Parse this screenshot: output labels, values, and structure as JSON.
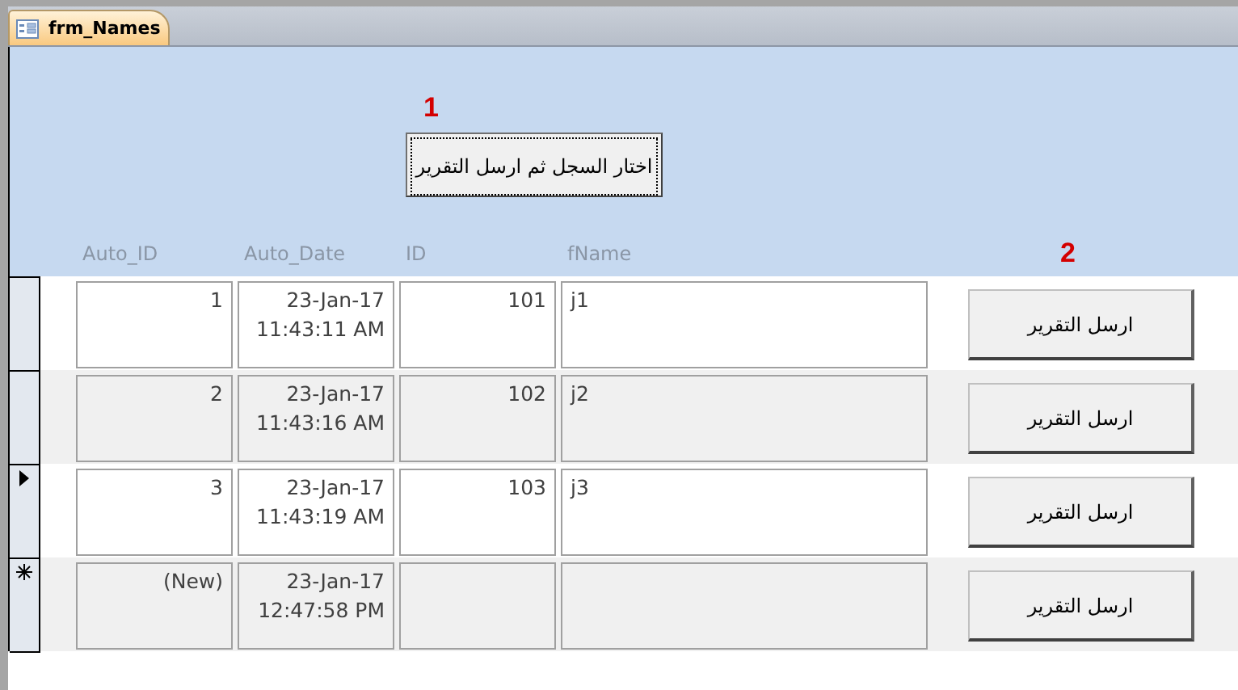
{
  "tab": {
    "title": "frm_Names",
    "selected": true
  },
  "header": {
    "marker_1": "1",
    "button": "اختار السجل ثم ارسل التقرير",
    "columns": [
      "Auto_ID",
      "Auto_Date",
      "ID",
      "fName"
    ],
    "marker_2": "2"
  },
  "rows": [
    {
      "kind": "record",
      "current": false,
      "auto_id": "1",
      "date": "23-Jan-17",
      "time": "11:43:11 AM",
      "id": "101",
      "fname": "j1",
      "button": "ارسل التقرير"
    },
    {
      "kind": "record",
      "current": false,
      "auto_id": "2",
      "date": "23-Jan-17",
      "time": "11:43:16 AM",
      "id": "102",
      "fname": "j2",
      "button": "ارسل التقرير"
    },
    {
      "kind": "record",
      "current": true,
      "auto_id": "3",
      "date": "23-Jan-17",
      "time": "11:43:19 AM",
      "id": "103",
      "fname": "j3",
      "button": "ارسل التقرير"
    },
    {
      "kind": "new",
      "current": false,
      "auto_id": "(New)",
      "date": "23-Jan-17",
      "time": "12:47:58 PM",
      "button": "ارسل التقرير"
    }
  ]
}
